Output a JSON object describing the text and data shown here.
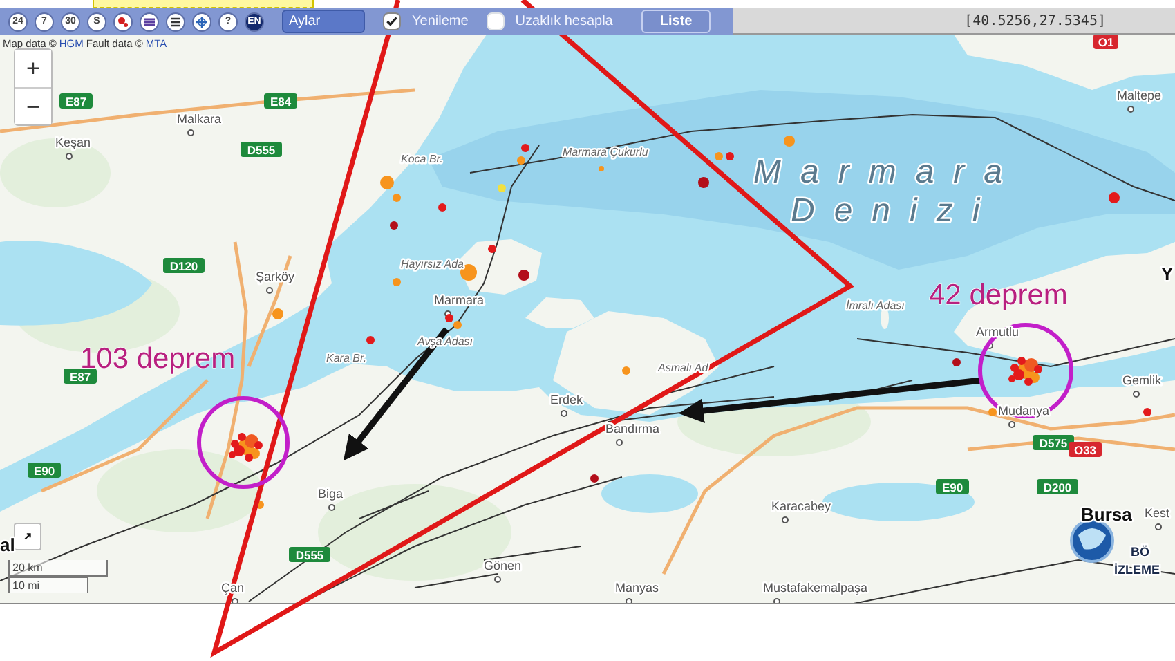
{
  "toolbar": {
    "buttons": [
      {
        "kind": "text",
        "label": "24"
      },
      {
        "kind": "text",
        "label": "7"
      },
      {
        "kind": "text",
        "label": "30"
      },
      {
        "kind": "text",
        "label": "S"
      },
      {
        "kind": "marker"
      },
      {
        "kind": "layers"
      },
      {
        "kind": "list"
      },
      {
        "kind": "move"
      },
      {
        "kind": "text",
        "label": "?"
      },
      {
        "kind": "lang",
        "label": "EN"
      }
    ],
    "period": {
      "value": "Aylar"
    },
    "options": [
      {
        "label": "Yenileme",
        "checked": true
      },
      {
        "label": "Uzaklık hesapla",
        "checked": false
      }
    ],
    "list_button": "Liste",
    "coordinates": "[40.5256,27.5345]"
  },
  "map": {
    "attribution": [
      {
        "text": "Map data ©",
        "link": false
      },
      {
        "text": "HGM",
        "link": true
      },
      {
        "text": "Fault data ©",
        "link": false
      },
      {
        "text": "MTA",
        "link": true
      }
    ],
    "zoom": [
      "+",
      "−"
    ],
    "places": [
      {
        "name": "Malkara",
        "kind": "town"
      },
      {
        "name": "Keşan",
        "kind": "town"
      },
      {
        "name": "Şarköy",
        "kind": "town"
      },
      {
        "name": "Koca Br.",
        "kind": "feature"
      },
      {
        "name": "Marmara Çukurlu",
        "kind": "feature"
      },
      {
        "name": "Hayırsız Ada",
        "kind": "feature"
      },
      {
        "name": "Marmara",
        "kind": "town"
      },
      {
        "name": "Kara Br.",
        "kind": "feature"
      },
      {
        "name": "Avşa Adası",
        "kind": "feature"
      },
      {
        "name": "Maltepe",
        "kind": "town"
      },
      {
        "name": "İmralı Adası",
        "kind": "feature"
      },
      {
        "name": "Armutlu",
        "kind": "town"
      },
      {
        "name": "Asmalı Ad",
        "kind": "feature"
      },
      {
        "name": "Erdek",
        "kind": "town"
      },
      {
        "name": "Bandırma",
        "kind": "town"
      },
      {
        "name": "Mudanya",
        "kind": "town"
      },
      {
        "name": "Gemlik",
        "kind": "town"
      },
      {
        "name": "Biga",
        "kind": "town"
      },
      {
        "name": "Karacabey",
        "kind": "town"
      },
      {
        "name": "Bursa",
        "kind": "city"
      },
      {
        "name": "Kest",
        "kind": "town"
      },
      {
        "name": "Çan",
        "kind": "town"
      },
      {
        "name": "Gönen",
        "kind": "town"
      },
      {
        "name": "Manyas",
        "kind": "town"
      },
      {
        "name": "Mustafakemalpaşa",
        "kind": "town"
      },
      {
        "name": "al",
        "kind": "city"
      },
      {
        "name": "Y",
        "kind": "city"
      },
      {
        "name": "Marmara",
        "kind": "sea"
      },
      {
        "name": "Denizi",
        "kind": "sea"
      }
    ],
    "road_badges": [
      {
        "label": "E87",
        "color": "#1e8a3c"
      },
      {
        "label": "E84",
        "color": "#1e8a3c"
      },
      {
        "label": "D555",
        "color": "#1e8a3c"
      },
      {
        "label": "D120",
        "color": "#1e8a3c"
      },
      {
        "label": "E87",
        "color": "#1e8a3c"
      },
      {
        "label": "E90",
        "color": "#1e8a3c"
      },
      {
        "label": "D555",
        "color": "#1e8a3c"
      },
      {
        "label": "E90",
        "color": "#1e8a3c"
      },
      {
        "label": "D200",
        "color": "#1e8a3c"
      },
      {
        "label": "D575",
        "color": "#1e8a3c"
      },
      {
        "label": "O33",
        "color": "#d7262e"
      },
      {
        "label": "O1",
        "color": "#d7262e"
      }
    ],
    "earthquakes": [
      {
        "color": "#e31a1c"
      },
      {
        "color": "#f7941d"
      },
      {
        "color": "#f7941d"
      },
      {
        "color": "#f7941d"
      },
      {
        "color": "#f2e040"
      },
      {
        "color": "#e31a1c"
      },
      {
        "color": "#b30e1a"
      },
      {
        "color": "#e31a1c"
      },
      {
        "color": "#f7941d"
      },
      {
        "color": "#b30e1a"
      },
      {
        "color": "#f7941d"
      },
      {
        "color": "#f7941d"
      },
      {
        "color": "#e31a1c"
      },
      {
        "color": "#e31a1c"
      },
      {
        "color": "#f7941d"
      },
      {
        "color": "#f7941d"
      },
      {
        "color": "#f7941d"
      },
      {
        "color": "#f7941d"
      },
      {
        "color": "#e31a1c"
      },
      {
        "color": "#b30e1a"
      },
      {
        "color": "#e31a1c"
      },
      {
        "color": "#f7941d"
      },
      {
        "color": "#b30e1a"
      },
      {
        "color": "#f7941d"
      },
      {
        "color": "#b30e1a"
      },
      {
        "color": "#e31a1c"
      },
      {
        "color": "#f7941d"
      }
    ],
    "scale": [
      "20 km",
      "10 mi"
    ]
  },
  "annotations": [
    {
      "text": "103 deprem"
    },
    {
      "text": "42 deprem"
    }
  ],
  "logo": [
    "BÖ",
    "İZLEME"
  ]
}
